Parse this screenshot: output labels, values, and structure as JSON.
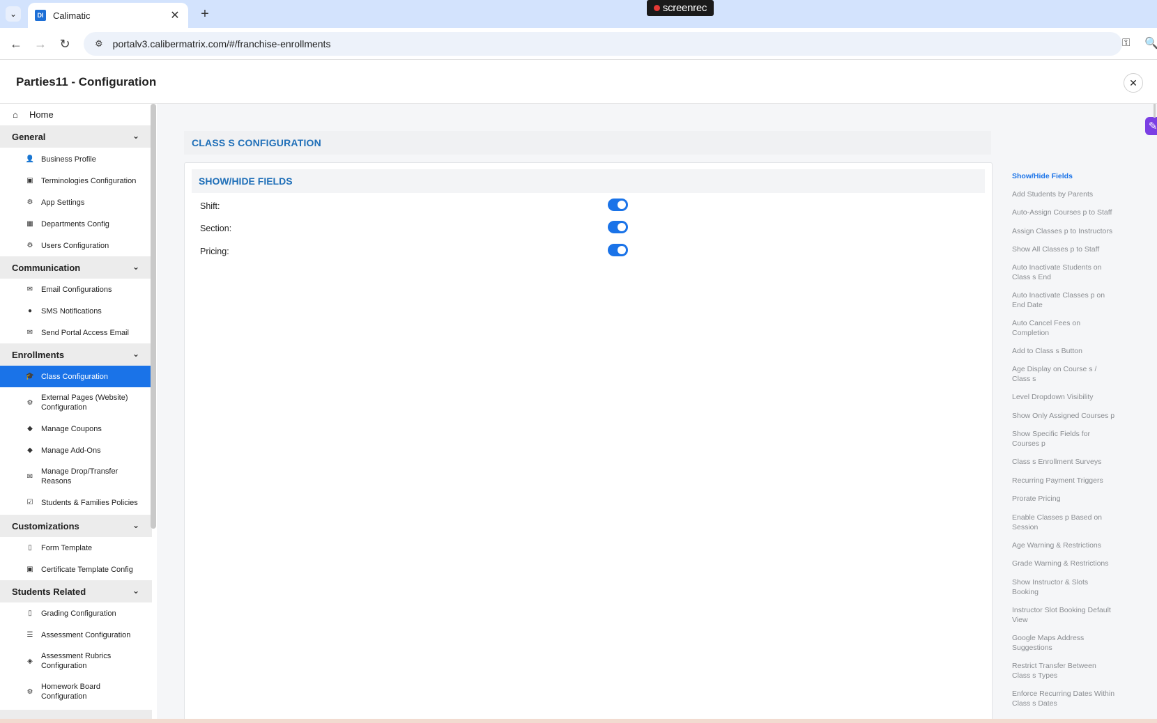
{
  "browser": {
    "tab_title": "Calimatic",
    "tab_favicon": "DI",
    "url": "portalv3.calibermatrix.com/#/franchise-enrollments",
    "recorder_label": "screenrec",
    "icons": {
      "dropdown": "chevron-down-icon",
      "back": "arrow-left-icon",
      "forward": "arrow-right-icon",
      "reload": "reload-icon",
      "site_info": "tune-icon",
      "password": "key-icon",
      "zoom": "magnifier-icon"
    }
  },
  "header": {
    "title": "Parties11 - Configuration"
  },
  "sidebar": {
    "home": "Home",
    "sections": [
      {
        "title": "General",
        "items": [
          {
            "label": "Business Profile",
            "icon": "user-icon"
          },
          {
            "label": "Terminologies Configuration",
            "icon": "image-icon"
          },
          {
            "label": "App Settings",
            "icon": "gears-icon"
          },
          {
            "label": "Departments Config",
            "icon": "building-icon"
          },
          {
            "label": "Users Configuration",
            "icon": "gears-icon"
          }
        ]
      },
      {
        "title": "Communication",
        "items": [
          {
            "label": "Email Configurations",
            "icon": "envelope-open-icon"
          },
          {
            "label": "SMS Notifications",
            "icon": "chat-icon"
          },
          {
            "label": "Send Portal Access Email",
            "icon": "envelope-icon"
          }
        ]
      },
      {
        "title": "Enrollments",
        "items": [
          {
            "label": "Class Configuration",
            "icon": "graduation-cap-icon",
            "active": true
          },
          {
            "label": "External Pages (Website)",
            "label2": "Configuration",
            "icon": "gears-icon"
          },
          {
            "label": "Manage Coupons",
            "icon": "tags-icon"
          },
          {
            "label": "Manage Add-Ons",
            "icon": "tags-icon"
          },
          {
            "label": "Manage Drop/Transfer",
            "label2": "Reasons",
            "icon": "envelope-icon"
          },
          {
            "label": "Students & Families Policies",
            "icon": "policy-icon"
          }
        ]
      },
      {
        "title": "Customizations",
        "items": [
          {
            "label": "Form Template",
            "icon": "file-icon"
          },
          {
            "label": "Certificate Template Config",
            "icon": "image-icon"
          }
        ]
      },
      {
        "title": "Students Related",
        "items": [
          {
            "label": "Grading Configuration",
            "icon": "file-icon"
          },
          {
            "label": "Assessment Configuration",
            "icon": "list-icon"
          },
          {
            "label": "Assessment Rubrics",
            "label2": "Configuration",
            "icon": "cube-icon"
          },
          {
            "label": "Homework Board",
            "label2": "Configuration",
            "icon": "gears-icon"
          }
        ]
      }
    ]
  },
  "main": {
    "section_title": "CLASS S CONFIGURATION",
    "card_title": "SHOW/HIDE FIELDS",
    "fields": [
      {
        "label": "Shift:",
        "enabled": true
      },
      {
        "label": "Section:",
        "enabled": true
      },
      {
        "label": "Pricing:",
        "enabled": true
      }
    ]
  },
  "anchor_nav": [
    {
      "label": "Show/Hide Fields",
      "active": true
    },
    {
      "label": "Add Students by Parents"
    },
    {
      "label": "Auto-Assign Courses p to Staff"
    },
    {
      "label": "Assign Classes p to Instructors"
    },
    {
      "label": "Show All Classes p to Staff"
    },
    {
      "label": "Auto Inactivate Students on",
      "label2": "Class s End"
    },
    {
      "label": "Auto Inactivate Classes p on",
      "label2": "End Date"
    },
    {
      "label": "Auto Cancel Fees on",
      "label2": "Completion"
    },
    {
      "label": "Add to Class s Button"
    },
    {
      "label": "Age Display on Course s /",
      "label2": "Class s"
    },
    {
      "label": "Level Dropdown Visibility"
    },
    {
      "label": "Show Only Assigned Courses p"
    },
    {
      "label": "Show Specific Fields for",
      "label2": "Courses p"
    },
    {
      "label": "Class s Enrollment Surveys"
    },
    {
      "label": "Recurring Payment Triggers"
    },
    {
      "label": "Prorate Pricing"
    },
    {
      "label": "Enable Classes p Based on",
      "label2": "Session"
    },
    {
      "label": "Age Warning & Restrictions"
    },
    {
      "label": "Grade Warning & Restrictions"
    },
    {
      "label": "Show Instructor & Slots",
      "label2": "Booking"
    },
    {
      "label": "Instructor Slot Booking Default",
      "label2": "View"
    },
    {
      "label": "Google Maps Address",
      "label2": "Suggestions"
    },
    {
      "label": "Restrict Transfer Between",
      "label2": "Class s Types"
    },
    {
      "label": "Enforce Recurring Dates Within",
      "label2": "Class s Dates"
    }
  ],
  "colors": {
    "accent": "#1a73e8",
    "heading_blue": "#1f6fb8",
    "tabbar": "#d3e3fd"
  }
}
